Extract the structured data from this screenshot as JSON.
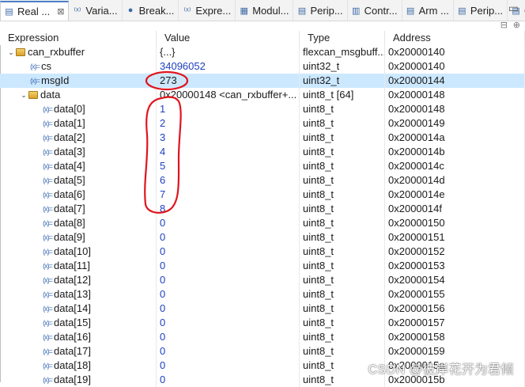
{
  "tabs": [
    {
      "label": "Real ...",
      "icon": "real-time-icon",
      "active": true,
      "close": "⊠"
    },
    {
      "label": "Varia...",
      "icon": "variables-icon"
    },
    {
      "label": "Break...",
      "icon": "breakpoints-icon"
    },
    {
      "label": "Expre...",
      "icon": "expressions-icon"
    },
    {
      "label": "Modul...",
      "icon": "modules-icon"
    },
    {
      "label": "Perip...",
      "icon": "peripherals-icon"
    },
    {
      "label": "Contr...",
      "icon": "controller-icon"
    },
    {
      "label": "Arm ...",
      "icon": "arm-icon"
    },
    {
      "label": "Perip...",
      "icon": "peripherals-icon"
    },
    {
      "label": "Outline",
      "icon": "outline-icon"
    }
  ],
  "columns": {
    "expression": "Expression",
    "value": "Value",
    "type": "Type",
    "address": "Address"
  },
  "rows": [
    {
      "name": "can_rxbuffer",
      "value": "{...}",
      "type": "flexcan_msgbuff...",
      "address": "0x20000140",
      "depth": 0,
      "expanded": true,
      "kind": "struct"
    },
    {
      "name": "cs",
      "value": "34096052",
      "type": "uint32_t",
      "address": "0x20000140",
      "depth": 1,
      "kind": "var",
      "blue": true
    },
    {
      "name": "msgId",
      "value": "273",
      "type": "uint32_t",
      "address": "0x20000144",
      "depth": 1,
      "kind": "var",
      "selected": true
    },
    {
      "name": "data",
      "value": "0x20000148 <can_rxbuffer+...",
      "type": "uint8_t [64]",
      "address": "0x20000148",
      "depth": 1,
      "expanded": true,
      "kind": "array"
    },
    {
      "name": "data[0]",
      "value": "1",
      "type": "uint8_t",
      "address": "0x20000148",
      "depth": 2,
      "kind": "var",
      "blue": true
    },
    {
      "name": "data[1]",
      "value": "2",
      "type": "uint8_t",
      "address": "0x20000149",
      "depth": 2,
      "kind": "var",
      "blue": true
    },
    {
      "name": "data[2]",
      "value": "3",
      "type": "uint8_t",
      "address": "0x2000014a",
      "depth": 2,
      "kind": "var",
      "blue": true
    },
    {
      "name": "data[3]",
      "value": "4",
      "type": "uint8_t",
      "address": "0x2000014b",
      "depth": 2,
      "kind": "var",
      "blue": true
    },
    {
      "name": "data[4]",
      "value": "5",
      "type": "uint8_t",
      "address": "0x2000014c",
      "depth": 2,
      "kind": "var",
      "blue": true
    },
    {
      "name": "data[5]",
      "value": "6",
      "type": "uint8_t",
      "address": "0x2000014d",
      "depth": 2,
      "kind": "var",
      "blue": true
    },
    {
      "name": "data[6]",
      "value": "7",
      "type": "uint8_t",
      "address": "0x2000014e",
      "depth": 2,
      "kind": "var",
      "blue": true
    },
    {
      "name": "data[7]",
      "value": "8",
      "type": "uint8_t",
      "address": "0x2000014f",
      "depth": 2,
      "kind": "var",
      "blue": true
    },
    {
      "name": "data[8]",
      "value": "0",
      "type": "uint8_t",
      "address": "0x20000150",
      "depth": 2,
      "kind": "var",
      "blue": true
    },
    {
      "name": "data[9]",
      "value": "0",
      "type": "uint8_t",
      "address": "0x20000151",
      "depth": 2,
      "kind": "var",
      "blue": true
    },
    {
      "name": "data[10]",
      "value": "0",
      "type": "uint8_t",
      "address": "0x20000152",
      "depth": 2,
      "kind": "var",
      "blue": true
    },
    {
      "name": "data[11]",
      "value": "0",
      "type": "uint8_t",
      "address": "0x20000153",
      "depth": 2,
      "kind": "var",
      "blue": true
    },
    {
      "name": "data[12]",
      "value": "0",
      "type": "uint8_t",
      "address": "0x20000154",
      "depth": 2,
      "kind": "var",
      "blue": true
    },
    {
      "name": "data[13]",
      "value": "0",
      "type": "uint8_t",
      "address": "0x20000155",
      "depth": 2,
      "kind": "var",
      "blue": true
    },
    {
      "name": "data[14]",
      "value": "0",
      "type": "uint8_t",
      "address": "0x20000156",
      "depth": 2,
      "kind": "var",
      "blue": true
    },
    {
      "name": "data[15]",
      "value": "0",
      "type": "uint8_t",
      "address": "0x20000157",
      "depth": 2,
      "kind": "var",
      "blue": true
    },
    {
      "name": "data[16]",
      "value": "0",
      "type": "uint8_t",
      "address": "0x20000158",
      "depth": 2,
      "kind": "var",
      "blue": true
    },
    {
      "name": "data[17]",
      "value": "0",
      "type": "uint8_t",
      "address": "0x20000159",
      "depth": 2,
      "kind": "var",
      "blue": true
    },
    {
      "name": "data[18]",
      "value": "0",
      "type": "uint8_t",
      "address": "0x2000015a",
      "depth": 2,
      "kind": "var",
      "blue": true
    },
    {
      "name": "data[19]",
      "value": "0",
      "type": "uint8_t",
      "address": "0x2000015b",
      "depth": 2,
      "kind": "var",
      "blue": true
    }
  ],
  "watermark": "CSDN @彼岸花开为君倾",
  "colors": {
    "selection": "#cce8ff",
    "value_blue": "#1f3fbf",
    "annotation_red": "#e0141e",
    "active_tab_accent": "#4b7ec5"
  }
}
